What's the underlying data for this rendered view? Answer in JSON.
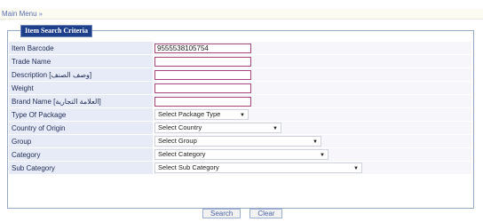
{
  "breadcrumb": {
    "label": "Main Menu",
    "sep": "»"
  },
  "form": {
    "legend": "Item Search Criteria",
    "rows": [
      {
        "label": "Item Barcode",
        "value": "9555538105754"
      },
      {
        "label": "Trade Name",
        "value": ""
      },
      {
        "label": "Description [وصف الصنف]",
        "value": ""
      },
      {
        "label": "Weight",
        "value": ""
      },
      {
        "label": "Brand Name [العلامة التجارية]",
        "value": ""
      },
      {
        "label": "Type Of Package",
        "value": "Select Package Type"
      },
      {
        "label": "Country of Origin",
        "value": "Select Country"
      },
      {
        "label": "Group",
        "value": "Select Group"
      },
      {
        "label": "Category",
        "value": "Select Category"
      },
      {
        "label": "Sub Category",
        "value": "Select Sub Category"
      }
    ]
  },
  "buttons": {
    "search": "Search",
    "clear": "Clear"
  },
  "icons": {
    "dropdown": "chevron-down-icon"
  }
}
